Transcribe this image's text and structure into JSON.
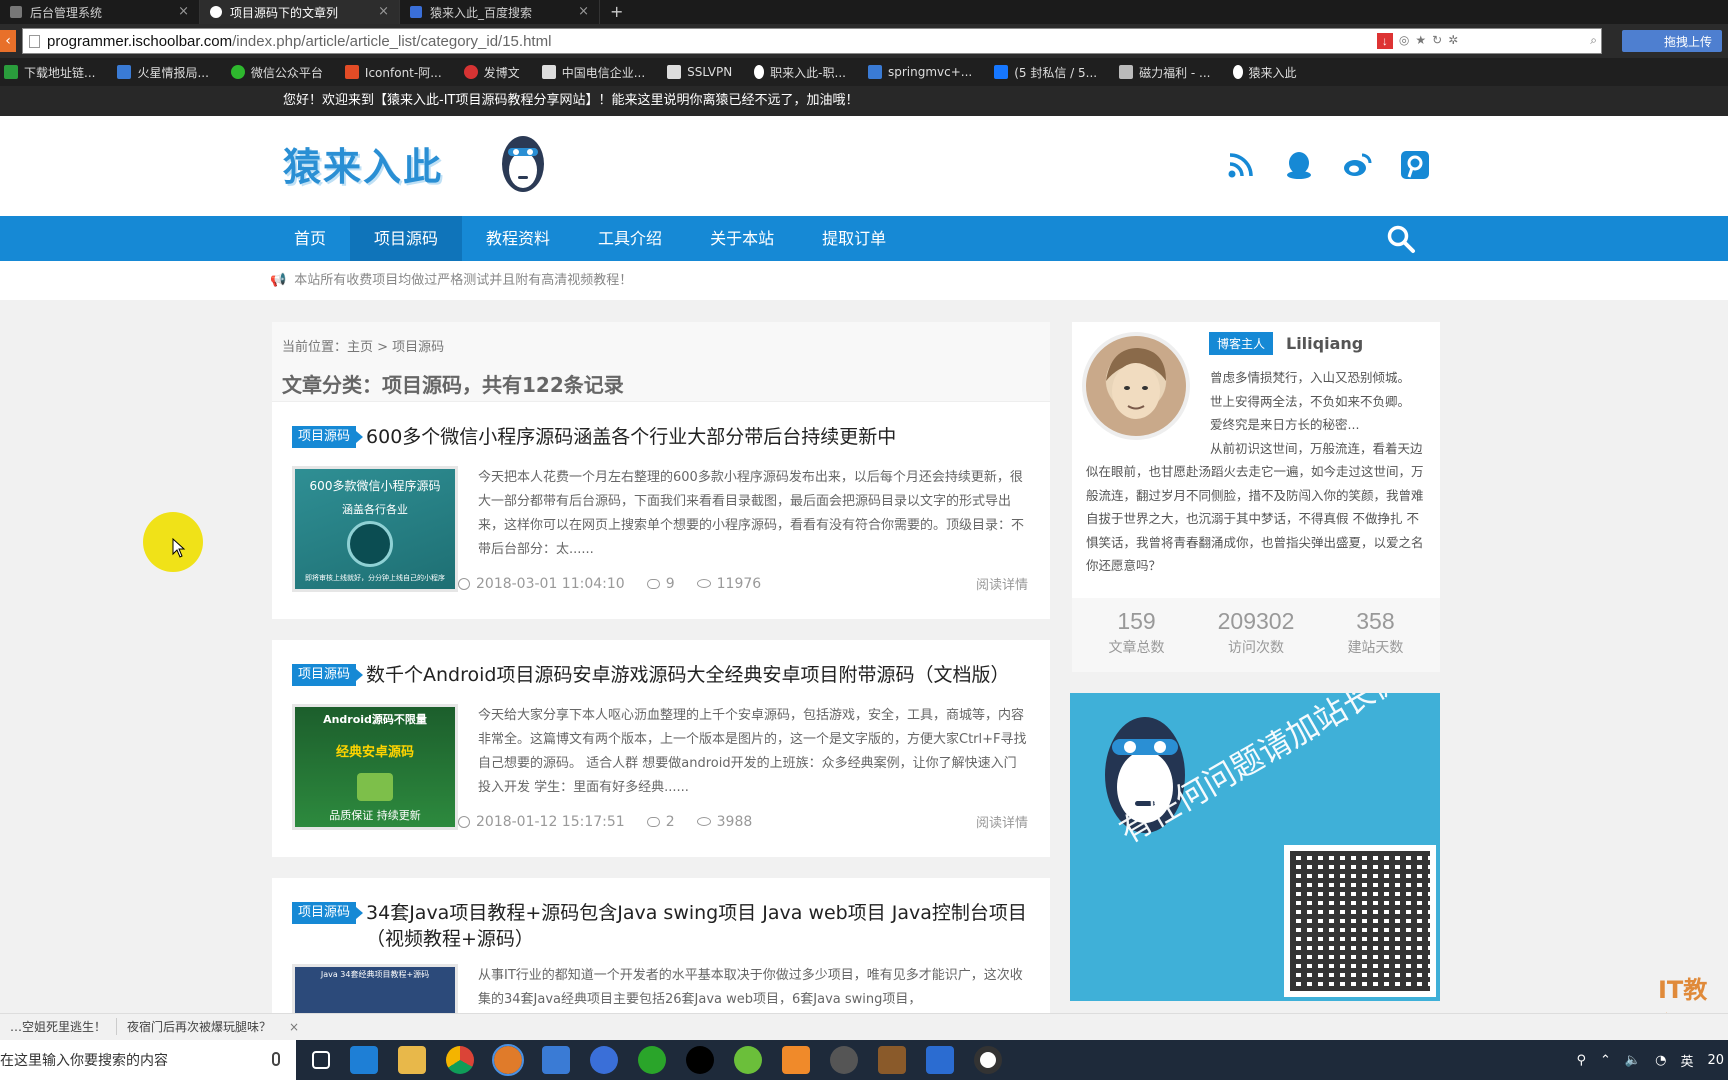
{
  "browser": {
    "tabs": [
      {
        "label": "后台管理系统",
        "active": false
      },
      {
        "label": "项目源码下的文章列",
        "active": true
      },
      {
        "label": "猿来入此_百度搜索",
        "active": false
      }
    ],
    "new_tab": "+",
    "url_domain": "programmer.ischoolbar.com",
    "url_path": "/index.php/article/article_list/category_id/15.html",
    "upload_button": "拖拽上传",
    "bookmarks": [
      {
        "label": "下载地址链...",
        "color": "#2a9d3c"
      },
      {
        "label": "火星情报局...",
        "color": "#3a7bd5"
      },
      {
        "label": "微信公众平台",
        "color": "#2eb82e"
      },
      {
        "label": "Iconfont-阿...",
        "color": "#e34c26"
      },
      {
        "label": "发博文",
        "color": "#d63333"
      },
      {
        "label": "中国电信企业...",
        "color": "#dddddd"
      },
      {
        "label": "SSLVPN",
        "color": "#dddddd"
      },
      {
        "label": "职来入此-职...",
        "color": "#ffffff"
      },
      {
        "label": "springmvc+...",
        "color": "#3a7bd5"
      },
      {
        "label": "(5 封私信 / 5...",
        "color": "#1677ff"
      },
      {
        "label": "磁力福利 - ...",
        "color": "#bbbbbb"
      },
      {
        "label": "猿来入此",
        "color": "#ffffff"
      }
    ]
  },
  "site": {
    "welcome": "您好！欢迎来到【猿来入此-IT项目源码教程分享网站】！能来这里说明你离猿已经不远了，加油哦！",
    "logo": "猿来入此",
    "nav": [
      {
        "label": "首页",
        "active": false
      },
      {
        "label": "项目源码",
        "active": true
      },
      {
        "label": "教程资料",
        "active": false
      },
      {
        "label": "工具介绍",
        "active": false
      },
      {
        "label": "关于本站",
        "active": false
      },
      {
        "label": "提取订单",
        "active": false
      }
    ],
    "announcement": "本站所有收费项目均做过严格测试并且附有高清视频教程！",
    "breadcrumb": "当前位置：主页 > 项目源码",
    "category_title": "文章分类：项目源码，共有122条记录",
    "articles": [
      {
        "tag": "项目源码",
        "title": "600多个微信小程序源码涵盖各个行业大部分带后台持续更新中",
        "thumb_top": "600多款微信小程序源码",
        "thumb_mid": "涵盖各行各业",
        "thumb_bottom": "即将审核上线就好，分分钟上线自己的小程序",
        "excerpt": "今天把本人花费一个月左右整理的600多款小程序源码发布出来，以后每个月还会持续更新，很大一部分都带有后台源码，下面我们来看看目录截图，最后面会把源码目录以文字的形式导出来，这样你可以在网页上搜索单个想要的小程序源码，看看有没有符合你需要的。顶级目录：不带后台部分：太......",
        "date": "2018-03-01 11:04:10",
        "comments": "9",
        "views": "11976",
        "more": "阅读详情"
      },
      {
        "tag": "项目源码",
        "title": "数千个Android项目源码安卓游戏源码大全经典安卓项目附带源码（文档版）",
        "thumb_top": "Android源码不限量",
        "thumb_mid": "经典安卓源码",
        "thumb_bottom": "品质保证 持续更新",
        "excerpt": "今天给大家分享下本人呕心沥血整理的上千个安卓源码，包括游戏，安全，工具，商城等，内容非常全。这篇博文有两个版本，上一个版本是图片的，这一个是文字版的，方便大家Ctrl+F寻找自己想要的源码。 适合人群 想要做android开发的上班族：众多经典案例，让你了解快速入门投入开发 学生：里面有好多经典......",
        "date": "2018-01-12 15:17:51",
        "comments": "2",
        "views": "3988",
        "more": "阅读详情"
      },
      {
        "tag": "项目源码",
        "title": "34套Java项目教程+源码包含Java swing项目 Java web项目 Java控制台项目（视频教程+源码）",
        "thumb_top": "Java 34套经典项目教程+源码",
        "thumb_mid": "",
        "thumb_bottom": "",
        "excerpt": "从事IT行业的都知道一个开发者的水平基本取决于你做过多少项目，唯有见多才能识广，这次收集的34套Java经典项目主要包括26套Java web项目，6套Java swing项目，",
        "date": "",
        "comments": "",
        "views": "",
        "more": ""
      }
    ],
    "author": {
      "badge": "博客主人",
      "name": "Liliqiang",
      "bio_lines": [
        "曾虑多情损梵行，入山又恐别倾城。",
        "世上安得两全法，不负如来不负卿。",
        "爱终究是来日方长的秘密...",
        "从前初识这世间，万般流连，看着天边",
        "似在眼前，也甘愿赴汤蹈火去走它一遍，如今走过这世间，万般流连，翻过岁月不同侧脸，措不及防闯入你的笑颜，我曾难自拔于世界之大，也沉溺于其中梦话，不得真假 不做挣扎 不惧笑话，我曾将青春翻涌成你，也曾指尖弹出盛夏，以爱之名 你还愿意吗？"
      ],
      "stats": [
        {
          "num": "159",
          "label": "文章总数"
        },
        {
          "num": "209302",
          "label": "访问次数"
        },
        {
          "num": "358",
          "label": "建站天数"
        }
      ]
    },
    "wechat_banner": "有任何问题请加站长微信",
    "watermark": "IT教程"
  },
  "os": {
    "news": [
      "…空姐死里逃生！",
      "夜宿门后再次被爆玩腿味？"
    ],
    "news_close": "×",
    "search_placeholder": "在这里输入你要搜索的内容",
    "tray_lang": "英",
    "tray_time": "20"
  },
  "colors": {
    "brand_blue": "#1689d5",
    "nav_active": "#0f74ba",
    "wechat_bg": "#3fb0d8"
  }
}
